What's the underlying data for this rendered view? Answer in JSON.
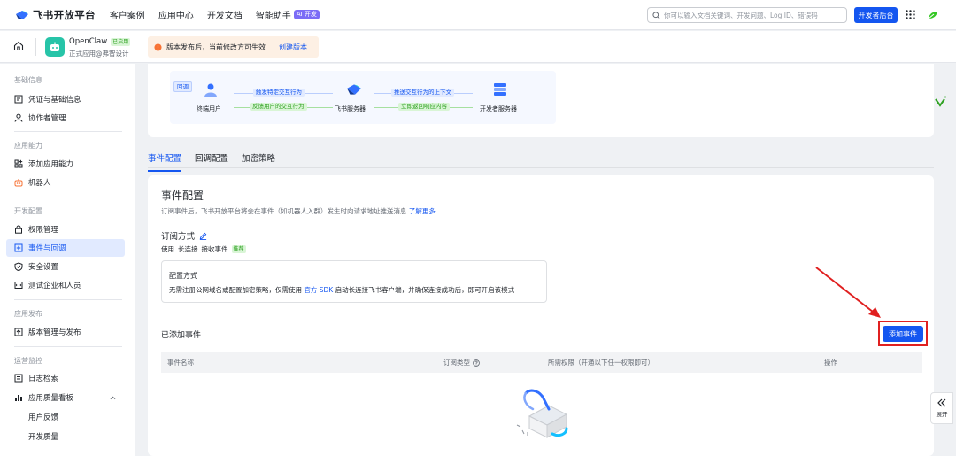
{
  "topbar": {
    "brand": "飞书开放平台",
    "nav": [
      "客户案例",
      "应用中心",
      "开发文档",
      "智能助手"
    ],
    "ai_badge": "AI 开发",
    "search_placeholder": "你可以输入文档关键词、开发问题、Log ID、错误码",
    "dev_console": "开发者后台"
  },
  "app": {
    "name": "OpenClaw",
    "status": "已启用",
    "subtitle": "正式应用@弗智设计"
  },
  "notice": {
    "text": "版本发布后，当前修改方可生效",
    "link": "创建版本"
  },
  "sidebar": {
    "groups": [
      {
        "title": "基础信息",
        "items": [
          {
            "label": "凭证与基础信息",
            "icon": "document-icon"
          },
          {
            "label": "协作者管理",
            "icon": "user-icon"
          }
        ]
      },
      {
        "title": "应用能力",
        "items": [
          {
            "label": "添加应用能力",
            "icon": "apps-add-icon"
          },
          {
            "label": "机器人",
            "icon": "robot-icon"
          }
        ]
      },
      {
        "title": "开发配置",
        "items": [
          {
            "label": "权限管理",
            "icon": "lock-icon"
          },
          {
            "label": "事件与回调",
            "icon": "event-icon"
          },
          {
            "label": "安全设置",
            "icon": "shield-icon"
          },
          {
            "label": "测试企业和人员",
            "icon": "test-icon"
          }
        ]
      },
      {
        "title": "应用发布",
        "items": [
          {
            "label": "版本管理与发布",
            "icon": "upload-icon"
          }
        ]
      },
      {
        "title": "运营监控",
        "items": [
          {
            "label": "日志检索",
            "icon": "log-icon"
          },
          {
            "label": "应用质量看板",
            "icon": "chart-icon"
          }
        ]
      }
    ],
    "sub_items": [
      "用户反馈",
      "开发质量"
    ],
    "active": "事件与回调"
  },
  "flow": {
    "callback_tag": "回调",
    "nodes": [
      "终端用户",
      "飞书服务器",
      "开发者服务器"
    ],
    "arrows": [
      "触发特定交互行为",
      "反馈用户的交互行为",
      "推送交互行为的上下文",
      "立即返回响应内容"
    ]
  },
  "tabs": [
    "事件配置",
    "回调配置",
    "加密策略"
  ],
  "active_tab": "事件配置",
  "event_config": {
    "title": "事件配置",
    "desc": "订阅事件后，飞书开放平台将会在事件（如机器人入群）发生时向请求地址推送消息",
    "learn_more": "了解更多",
    "sub_title": "订阅方式",
    "mode_use": "使用",
    "mode_name": "长连接",
    "mode_suffix": "接收事件",
    "recommend": "推荐",
    "cfg_title": "配置方式",
    "cfg_desc_1": "无需注册公网域名或配置加密策略，仅需使用",
    "cfg_link": "官方 SDK",
    "cfg_desc_2": "启动长连接飞书客户端，并确保连接成功后，即可开启该模式"
  },
  "added_events": {
    "title": "已添加事件",
    "add_button": "添加事件",
    "columns": [
      "事件名称",
      "订阅类型",
      "所需权限（开通以下任一权限即可）",
      "操作"
    ]
  },
  "float": {
    "expand": "展开"
  },
  "colors": {
    "primary": "#1456f0",
    "highlight_red": "#e02020",
    "success_green": "#2ea121",
    "app_icon": "#27c4a8"
  }
}
